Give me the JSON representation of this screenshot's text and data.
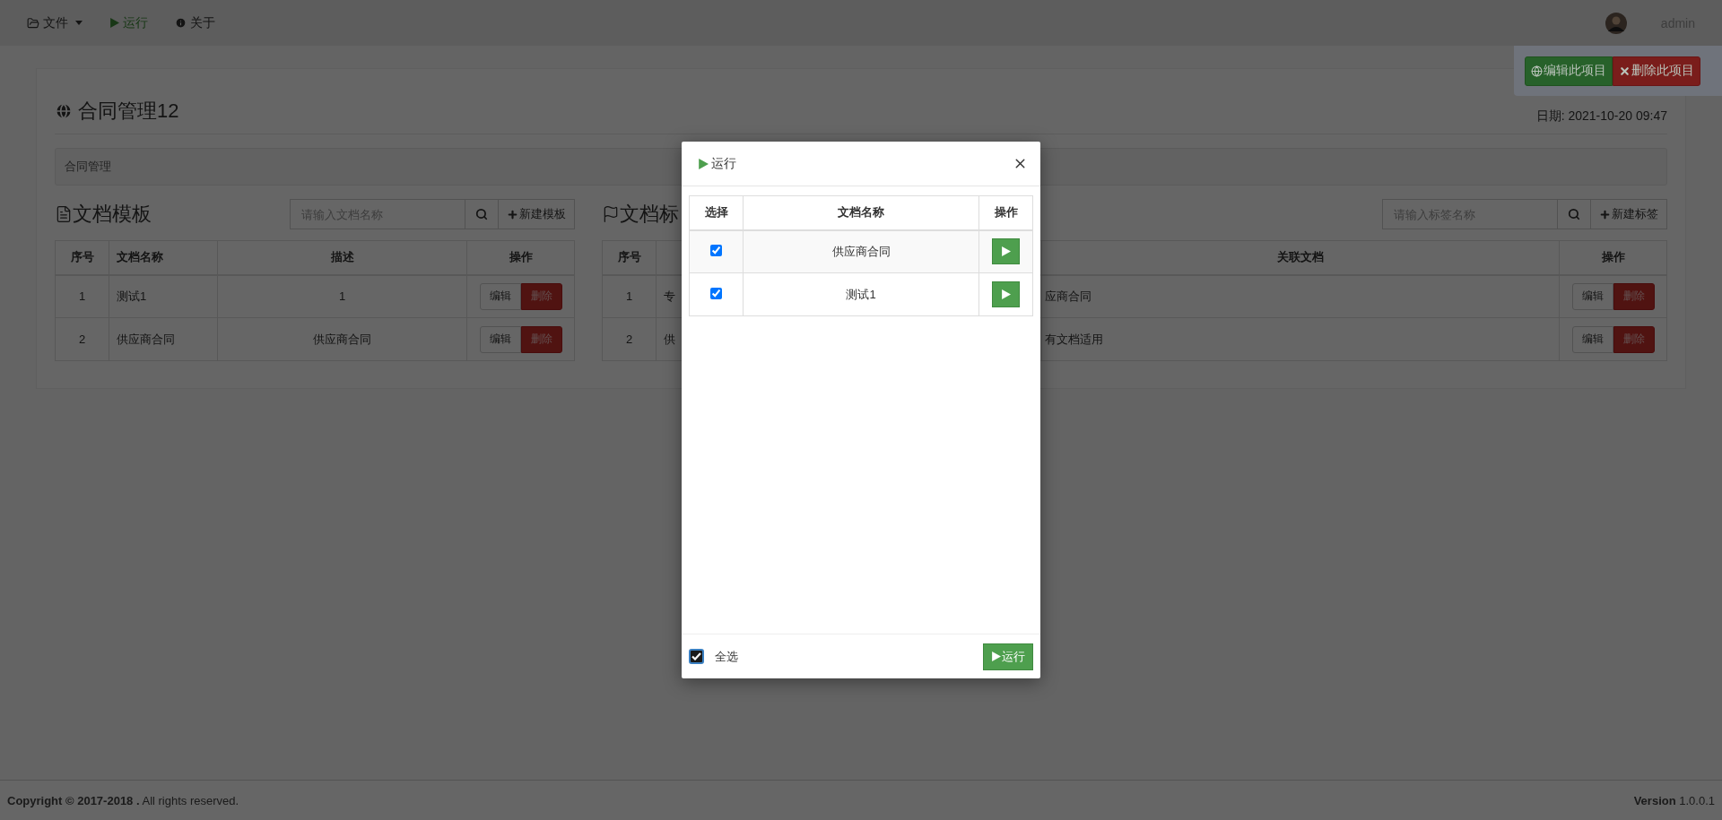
{
  "navbar": {
    "menu": [
      {
        "kind": "dropdown",
        "label": "文件"
      },
      {
        "kind": "run",
        "label": "运行"
      },
      {
        "kind": "info",
        "label": "关于"
      }
    ],
    "user": {
      "name": "admin"
    }
  },
  "actions": [
    {
      "kind": "edit",
      "label": "编辑此项目"
    },
    {
      "kind": "delete",
      "label": "删除此项目"
    }
  ],
  "project": {
    "title": "合同管理12",
    "date": "日期: 2021-10-20 09:47",
    "breadcrumb": "合同管理"
  },
  "templates": {
    "title": "文档模板",
    "search": {
      "placeholder": "请输入文档名称"
    },
    "add_button": "新建模板",
    "columns": [
      "序号",
      "文档名称",
      "描述",
      "操作"
    ],
    "rows": [
      {
        "number": "1",
        "name": "测试1",
        "description": "1",
        "actions": [
          "编辑",
          "删除"
        ]
      },
      {
        "number": "2",
        "name": "供应商合同",
        "description": "供应商合同",
        "actions": [
          "编辑",
          "删除"
        ]
      }
    ]
  },
  "tags": {
    "title": "文档标",
    "search": {
      "placeholder": "请输入标签名称"
    },
    "add_button": "新建标签",
    "columns": {
      "number": "序号",
      "related": "关联文档",
      "actions": "操作"
    },
    "rows": [
      {
        "number": "1",
        "name": "专",
        "related": "应商合同",
        "actions": [
          "编辑",
          "删除"
        ]
      },
      {
        "number": "2",
        "name": "供",
        "related": "有文档适用",
        "actions": [
          "编辑",
          "删除"
        ]
      }
    ]
  },
  "modal": {
    "title": "运行",
    "columns": [
      "选择",
      "文档名称",
      "操作"
    ],
    "rows": [
      {
        "checked": true,
        "name": "供应商合同"
      },
      {
        "checked": true,
        "name": "测试1"
      }
    ],
    "select_all": {
      "label": "全选",
      "checked": true
    },
    "run_button": "运行"
  },
  "footer": {
    "copyright": "**Copyright © 2017-2018 .** All rights reserved.",
    "version": "**Version** 1.0.0.1"
  }
}
